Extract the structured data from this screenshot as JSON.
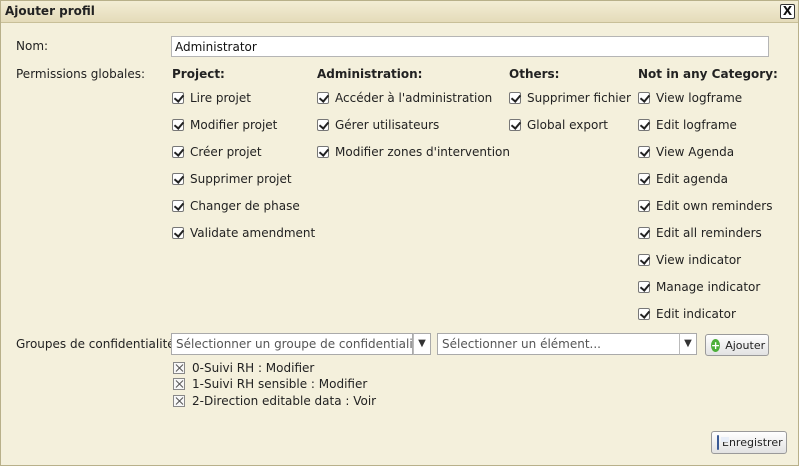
{
  "dialog": {
    "title": "Ajouter profil",
    "close_label": "X"
  },
  "form": {
    "name_label": "Nom:",
    "name_value": "Administrator",
    "permissions_label": "Permissions globales:",
    "confidentiality_label": "Groupes de confidentialité:"
  },
  "permission_categories": [
    {
      "title": "Project:",
      "items": [
        "Lire projet",
        "Modifier projet",
        "Créer projet",
        "Supprimer projet",
        "Changer de phase",
        "Validate amendment"
      ]
    },
    {
      "title": "Administration:",
      "items": [
        "Accéder à l'administration",
        "Gérer utilisateurs",
        "Modifier zones d'intervention"
      ]
    },
    {
      "title": "Others:",
      "items": [
        "Supprimer fichier",
        "Global export"
      ]
    },
    {
      "title": "Not in any Category:",
      "items": [
        "View logframe",
        "Edit logframe",
        "View Agenda",
        "Edit agenda",
        "Edit own reminders",
        "Edit all reminders",
        "View indicator",
        "Manage indicator",
        "Edit indicator"
      ]
    }
  ],
  "confidentiality": {
    "group_select_placeholder": "Sélectionner un groupe de confidentialité...",
    "element_select_placeholder": "Sélectionner un élément...",
    "add_label": "Ajouter",
    "groups": [
      "0-Suivi RH : Modifier",
      "1-Suivi RH sensible : Modifier",
      "2-Direction editable data : Voir"
    ]
  },
  "save_label": "Enregistrer"
}
